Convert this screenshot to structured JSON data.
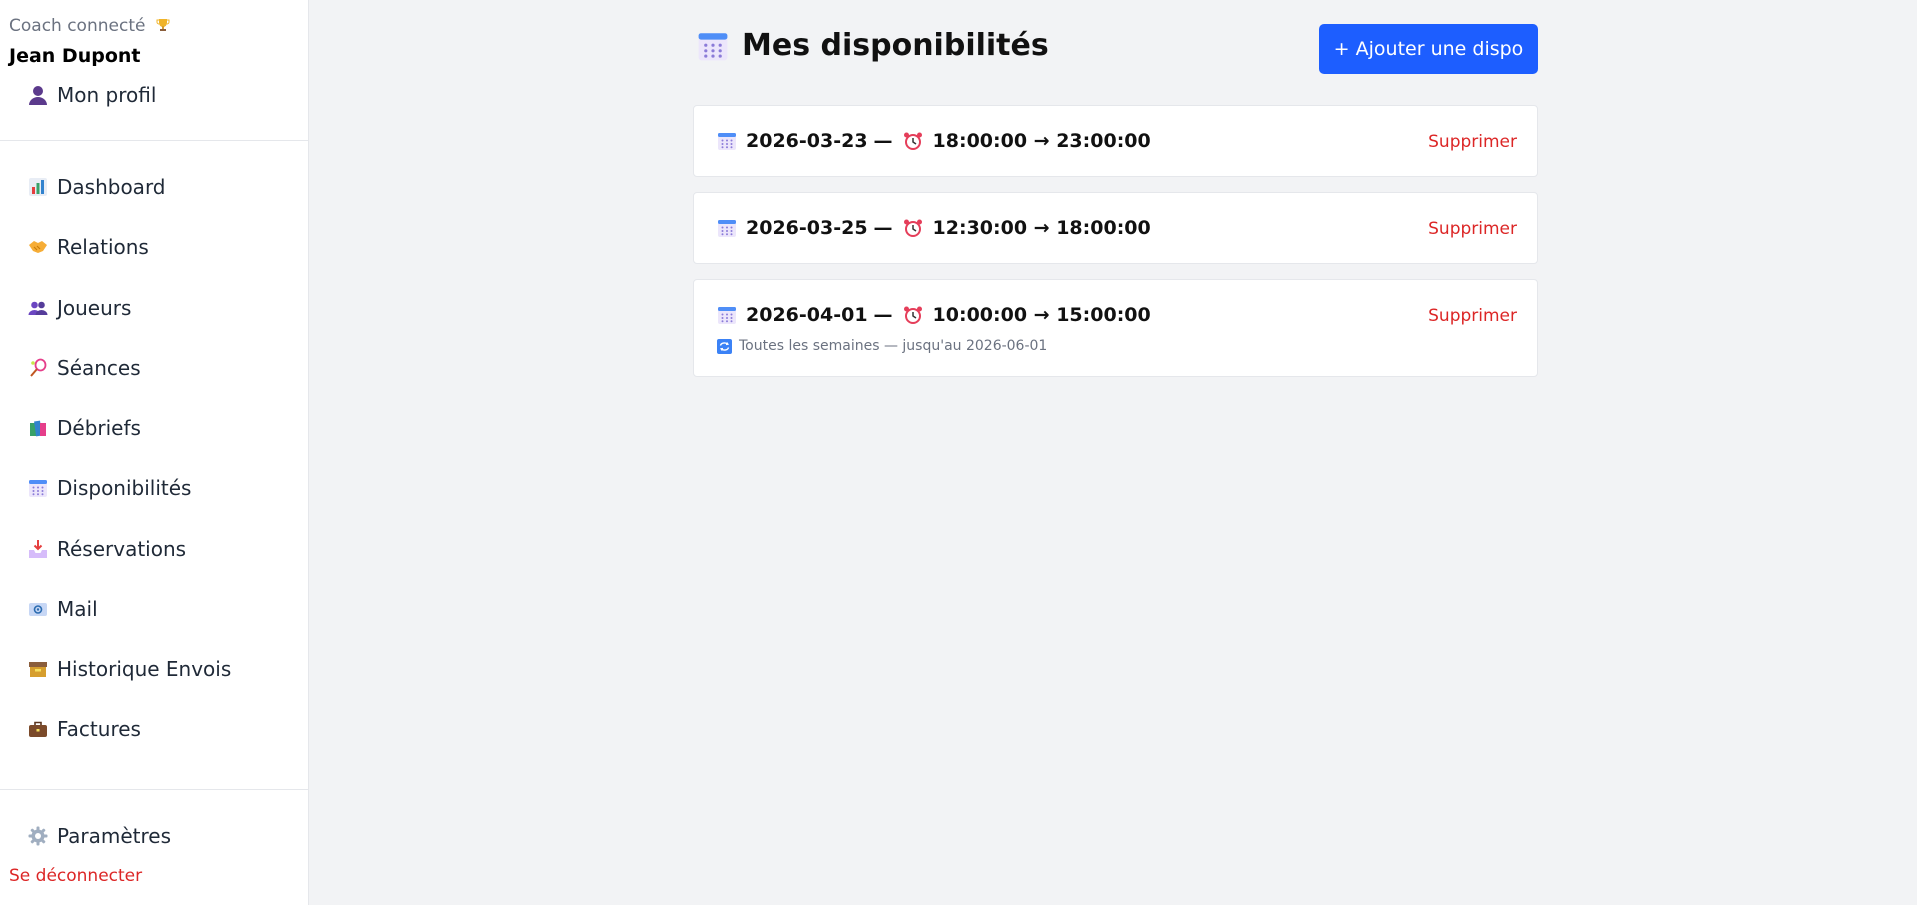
{
  "sidebar": {
    "coach_label": "Coach connecté",
    "coach_name": "Jean Dupont",
    "profile": {
      "label": "Mon profil",
      "icon": "user-icon"
    },
    "items": [
      {
        "label": "Dashboard",
        "icon": "bar-chart-icon"
      },
      {
        "label": "Relations",
        "icon": "handshake-icon"
      },
      {
        "label": "Joueurs",
        "icon": "users-icon"
      },
      {
        "label": "Séances",
        "icon": "tennis-racket-icon"
      },
      {
        "label": "Débriefs",
        "icon": "books-icon"
      },
      {
        "label": "Disponibilités",
        "icon": "calendar-icon"
      },
      {
        "label": "Réservations",
        "icon": "inbox-tray-icon"
      },
      {
        "label": "Mail",
        "icon": "mail-icon"
      },
      {
        "label": "Historique Envois",
        "icon": "archive-box-icon"
      },
      {
        "label": "Factures",
        "icon": "briefcase-icon"
      }
    ],
    "settings": {
      "label": "Paramètres",
      "icon": "gear-icon"
    },
    "logout": "Se déconnecter"
  },
  "main": {
    "title": "Mes disponibilités",
    "add_button": "+ Ajouter une dispo",
    "slots": [
      {
        "date": "2026-03-23",
        "sep": "—",
        "time": "18:00:00 → 23:00:00",
        "delete": "Supprimer",
        "recurrence": ""
      },
      {
        "date": "2026-03-25",
        "sep": "—",
        "time": "12:30:00 → 18:00:00",
        "delete": "Supprimer",
        "recurrence": ""
      },
      {
        "date": "2026-04-01",
        "sep": "—",
        "time": "10:00:00 → 15:00:00",
        "delete": "Supprimer",
        "recurrence": "Toutes les semaines — jusqu'au 2026-06-01"
      }
    ]
  },
  "colors": {
    "accent": "#1d5eff",
    "danger": "#dc2626",
    "background": "#f2f3f5"
  }
}
